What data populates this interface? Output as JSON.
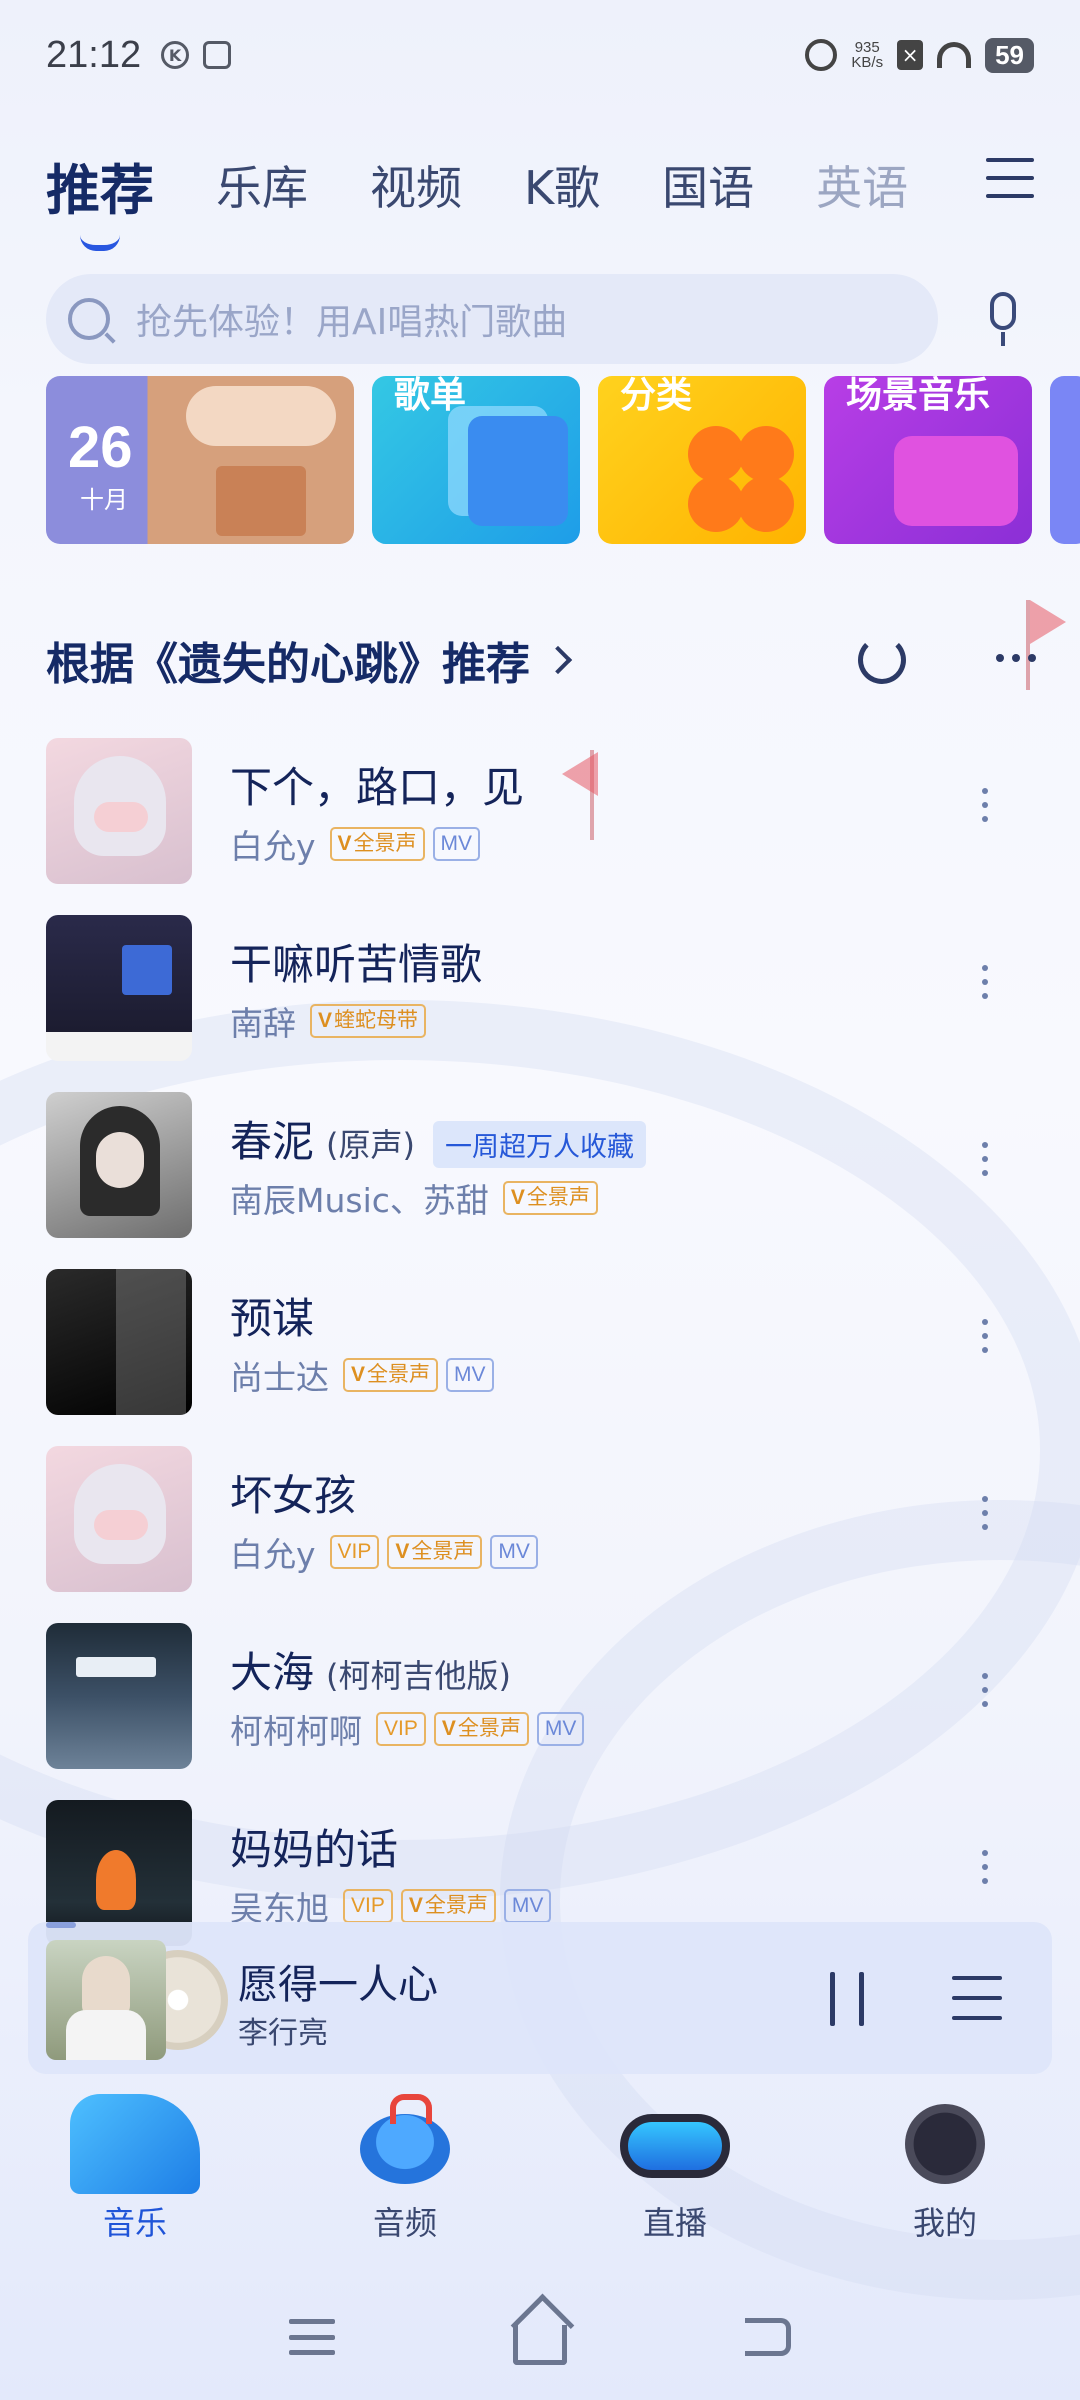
{
  "status_bar": {
    "time": "21:12",
    "net_speed_value": "935",
    "net_speed_unit": "KB/s",
    "battery": "59",
    "xbox_icon": "x-icon"
  },
  "top_tabs": [
    {
      "label": "推荐",
      "active": true
    },
    {
      "label": "乐库"
    },
    {
      "label": "视频"
    },
    {
      "label": "K歌"
    },
    {
      "label": "国语"
    },
    {
      "label": "英语"
    }
  ],
  "search": {
    "placeholder": "抢先体验！用AI唱热门歌曲"
  },
  "cards": {
    "daily": {
      "day": "26",
      "month": "十月"
    },
    "playlist": {
      "title": "歌单"
    },
    "category": {
      "title": "分类"
    },
    "scene": {
      "title": "场景音乐"
    }
  },
  "section": {
    "title": "根据《遗失的心跳》推荐"
  },
  "songs": [
    {
      "title": "下个，路口，见",
      "version": "",
      "artist": "白允y",
      "tags": [
        "全景声",
        "MV"
      ]
    },
    {
      "title": "干嘛听苦情歌",
      "version": "",
      "artist": "南辞",
      "tags": [
        "蝰蛇母带"
      ]
    },
    {
      "title": "春泥",
      "version": "(原声)",
      "hot": "一周超万人收藏",
      "artist": "南辰Music、苏甜",
      "tags": [
        "全景声"
      ]
    },
    {
      "title": "预谋",
      "version": "",
      "artist": "尚士达",
      "tags": [
        "全景声",
        "MV"
      ]
    },
    {
      "title": "坏女孩",
      "version": "",
      "artist": "白允y",
      "tags": [
        "VIP",
        "全景声",
        "MV"
      ]
    },
    {
      "title": "大海",
      "version": "(柯柯吉他版)",
      "artist": "柯柯柯啊",
      "tags": [
        "VIP",
        "全景声",
        "MV"
      ]
    },
    {
      "title": "妈妈的话",
      "version": "",
      "artist": "吴东旭",
      "tags": [
        "VIP",
        "全景声",
        "MV"
      ]
    }
  ],
  "mini_player": {
    "title": "愿得一人心",
    "artist": "李行亮"
  },
  "bottom_nav": [
    {
      "label": "音乐",
      "active": true
    },
    {
      "label": "音频"
    },
    {
      "label": "直播"
    },
    {
      "label": "我的"
    }
  ],
  "colors": {
    "accent": "#2856e0",
    "title": "#152a66",
    "artist": "#6d7fab",
    "tag_gold": "#dd8f20"
  }
}
